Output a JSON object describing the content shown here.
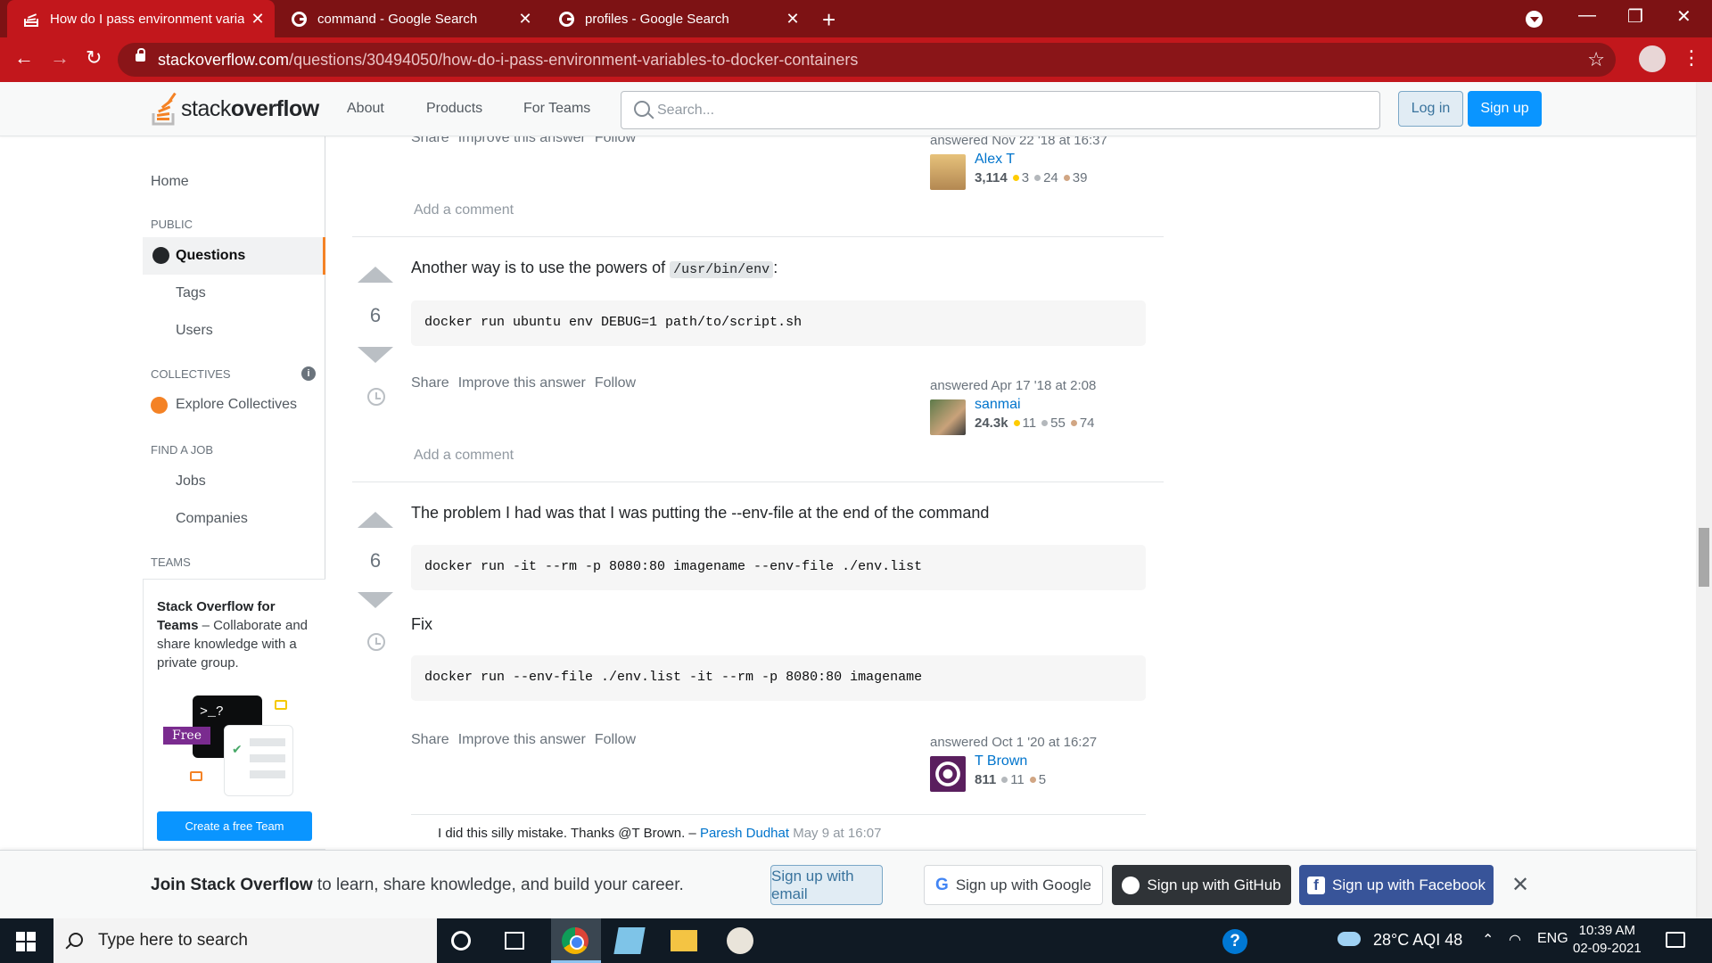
{
  "browser": {
    "tabs": [
      {
        "title": "How do I pass environment varia",
        "active": true
      },
      {
        "title": "command - Google Search",
        "active": false
      },
      {
        "title": "profiles - Google Search",
        "active": false
      }
    ],
    "url_host": "stackoverflow.com",
    "url_path": "/questions/30494050/how-do-i-pass-environment-variables-to-docker-containers"
  },
  "so_header": {
    "logo_light": "stack",
    "logo_bold": "overflow",
    "nav": [
      "About",
      "Products",
      "For Teams"
    ],
    "search_placeholder": "Search...",
    "login": "Log in",
    "signup": "Sign up"
  },
  "sidebar": {
    "home": "Home",
    "public_heading": "PUBLIC",
    "questions": "Questions",
    "tags": "Tags",
    "users": "Users",
    "collectives_heading": "COLLECTIVES",
    "explore_collectives": "Explore Collectives",
    "find_job_heading": "FIND A JOB",
    "jobs": "Jobs",
    "companies": "Companies",
    "teams_heading": "TEAMS",
    "teams_title": "Stack Overflow for Teams",
    "teams_desc": " – Collaborate and share knowledge with a private group.",
    "free_badge": "Free",
    "create_team": "Create a free Team",
    "illus_prompt": ">_?"
  },
  "answers": [
    {
      "actions": [
        "Share",
        "Improve this answer",
        "Follow"
      ],
      "answered": "answered Nov 22 '18 at 16:37",
      "user": "Alex T",
      "rep": "3,114",
      "gold": "3",
      "silver": "24",
      "bronze": "39",
      "add_comment": "Add a comment"
    },
    {
      "votes": "6",
      "text_before": "Another way is to use the powers of ",
      "inline_code": "/usr/bin/env",
      "text_after": ":",
      "code": "docker run ubuntu env DEBUG=1 path/to/script.sh",
      "actions": [
        "Share",
        "Improve this answer",
        "Follow"
      ],
      "answered": "answered Apr 17 '18 at 2:08",
      "user": "sanmai",
      "rep": "24.3k",
      "gold": "11",
      "silver": "55",
      "bronze": "74",
      "add_comment": "Add a comment"
    },
    {
      "votes": "6",
      "text": "The problem I had was that I was putting the --env-file at the end of the command",
      "code1": "docker run -it --rm -p 8080:80 imagename --env-file ./env.list",
      "fix": "Fix",
      "code2": "docker run --env-file ./env.list -it --rm -p 8080:80 imagename",
      "actions": [
        "Share",
        "Improve this answer",
        "Follow"
      ],
      "answered": "answered Oct 1 '20 at 16:27",
      "user": "T Brown",
      "rep": "811",
      "silver": "11",
      "bronze": "5",
      "comment_text": "I did this silly mistake. Thanks @T Brown. – ",
      "comment_user": "Paresh Dudhat",
      "comment_date": " May 9 at 16:07"
    }
  ],
  "signup_banner": {
    "bold": "Join Stack Overflow",
    "rest": " to learn, share knowledge, and build your career.",
    "email": "Sign up with email",
    "google": "Sign up with Google",
    "github": "Sign up with GitHub",
    "facebook": "Sign up with Facebook"
  },
  "taskbar": {
    "search_placeholder": "Type here to search",
    "weather": "28°C  AQI 48",
    "lang": "ENG",
    "time": "10:39 AM",
    "date": "02-09-2021"
  },
  "colors": {
    "chrome_tab_strip": "#7d1214",
    "chrome_toolbar": "#c2171c",
    "so_orange": "#f48225",
    "so_blue": "#0a95ff"
  }
}
